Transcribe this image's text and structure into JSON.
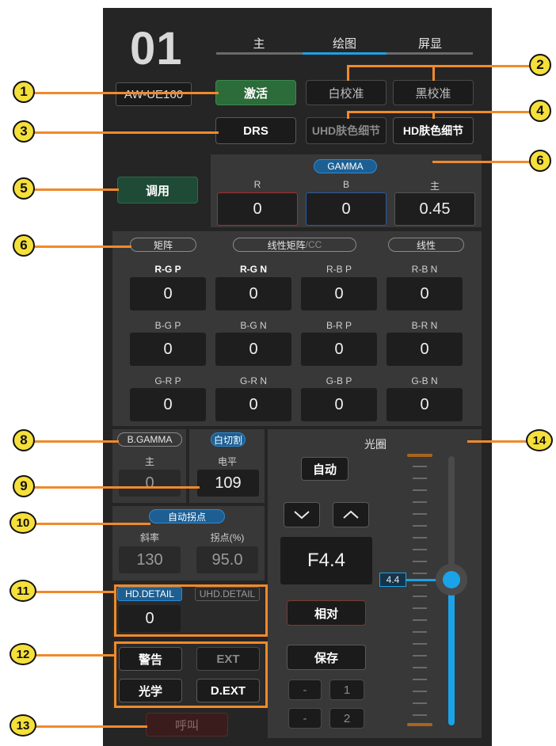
{
  "camera": {
    "number": "01",
    "model": "AW-UE160"
  },
  "tabs": [
    {
      "label": "主"
    },
    {
      "label": "绘图"
    },
    {
      "label": "屏显"
    }
  ],
  "buttons": {
    "activate": "激活",
    "white_cal": "白校准",
    "black_cal": "黑校准",
    "drs": "DRS",
    "uhd_skin": "UHD肤色细节",
    "hd_skin": "HD肤色细节",
    "recall": "调用",
    "call": "呼叫"
  },
  "gamma": {
    "title": "GAMMA",
    "fields": [
      {
        "label": "R",
        "value": "0"
      },
      {
        "label": "B",
        "value": "0"
      },
      {
        "label": "主",
        "value": "0.45"
      }
    ]
  },
  "matrix": {
    "tabs": {
      "matrix": "矩阵",
      "linear_matrix": "线性矩阵",
      "cc": "/CC",
      "linear": "线性"
    },
    "rows": [
      [
        {
          "label": "R-G P",
          "value": "0"
        },
        {
          "label": "R-G N",
          "value": "0"
        },
        {
          "label": "R-B P",
          "value": "0"
        },
        {
          "label": "R-B N",
          "value": "0"
        }
      ],
      [
        {
          "label": "B-G P",
          "value": "0"
        },
        {
          "label": "B-G N",
          "value": "0"
        },
        {
          "label": "B-R P",
          "value": "0"
        },
        {
          "label": "B-R N",
          "value": "0"
        }
      ],
      [
        {
          "label": "G-R P",
          "value": "0"
        },
        {
          "label": "G-R N",
          "value": "0"
        },
        {
          "label": "G-B P",
          "value": "0"
        },
        {
          "label": "G-B N",
          "value": "0"
        }
      ]
    ]
  },
  "bgamma": {
    "title": "B.GAMMA",
    "label": "主",
    "value": "0"
  },
  "white_clip": {
    "title": "白切割",
    "label": "电平",
    "value": "109"
  },
  "auto_knee": {
    "title": "自动拐点",
    "slope_label": "斜率",
    "slope_value": "130",
    "point_label": "拐点(%)",
    "point_value": "95.0"
  },
  "detail": {
    "hd_label": "HD.DETAIL",
    "hd_value": "0",
    "uhd_label": "UHD.DETAIL",
    "uhd_value": ""
  },
  "alarms": {
    "warning": "警告",
    "ext": "EXT",
    "optical": "光学",
    "dext": "D.EXT"
  },
  "iris": {
    "title": "光圈",
    "auto": "自动",
    "value": "F4.4",
    "slider_value": "4.4",
    "relative": "相对",
    "save": "保存",
    "preset_minus": "-",
    "preset_1": "1",
    "preset_2": "2",
    "level": 0.54
  },
  "callouts": [
    "1",
    "2",
    "3",
    "4",
    "5",
    "6",
    "6",
    "8",
    "9",
    "10",
    "11",
    "12",
    "13",
    "14"
  ],
  "colors": {
    "accent_blue": "#1aa3e8",
    "callout_yellow": "#f5df3a",
    "callout_line": "#f08a2a",
    "active_green": "#2c6b3a"
  }
}
